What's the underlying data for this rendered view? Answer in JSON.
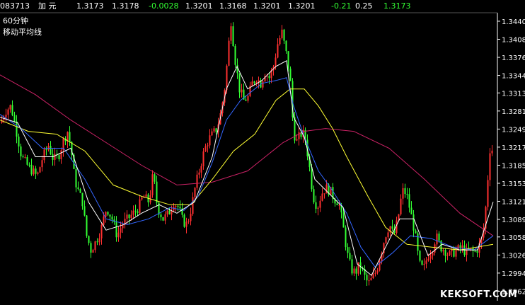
{
  "ticker": {
    "code": "083713",
    "name": "加 元",
    "values": [
      {
        "text": "1.3173",
        "color": "#ffffff"
      },
      {
        "text": "1.3178",
        "color": "#ffffff"
      },
      {
        "text": "-0.0028",
        "color": "#33ff33"
      },
      {
        "text": "1.3201",
        "color": "#ffffff"
      },
      {
        "text": "1.3168",
        "color": "#ffffff"
      },
      {
        "text": "1.3201",
        "color": "#ffffff"
      },
      {
        "text": "1.3201",
        "color": "#ffffff"
      },
      {
        "text": "-0.21",
        "color": "#33ff33"
      },
      {
        "text": "0.25",
        "color": "#ffffff"
      },
      {
        "text": "1.3173",
        "color": "#33ff33"
      }
    ]
  },
  "panel": {
    "period_label": "60分钟",
    "indicator_label": "移动平均线"
  },
  "watermark": "KEKSOFT.COM",
  "chart_data": {
    "type": "line",
    "title": "",
    "xlabel": "",
    "ylabel": "",
    "ylim": [
      1.2945,
      1.3455
    ],
    "grid": false,
    "y_ticks": [
      "1.3440",
      "1.3408",
      "1.3376",
      "1.3344",
      "1.3313",
      "1.3281",
      "1.3249",
      "1.3217",
      "1.3185",
      "1.3153",
      "1.3121",
      "1.3089",
      "1.3058",
      "1.3026",
      "1.2994",
      "1.2962"
    ],
    "colors": {
      "up": "#ff3030",
      "down": "#33ff33",
      "background": "#000000",
      "axis": "#ffffff"
    },
    "price_path": [
      [
        0,
        1.326
      ],
      [
        8,
        1.3282
      ],
      [
        15,
        1.329
      ],
      [
        22,
        1.325
      ],
      [
        30,
        1.32
      ],
      [
        38,
        1.3185
      ],
      [
        45,
        1.3175
      ],
      [
        52,
        1.3165
      ],
      [
        60,
        1.32
      ],
      [
        68,
        1.322
      ],
      [
        75,
        1.3195
      ],
      [
        82,
        1.32
      ],
      [
        88,
        1.3225
      ],
      [
        95,
        1.3245
      ],
      [
        100,
        1.3215
      ],
      [
        105,
        1.316
      ],
      [
        110,
        1.314
      ],
      [
        116,
        1.312
      ],
      [
        122,
        1.306
      ],
      [
        128,
        1.3035
      ],
      [
        135,
        1.305
      ],
      [
        142,
        1.307
      ],
      [
        150,
        1.311
      ],
      [
        158,
        1.309
      ],
      [
        165,
        1.306
      ],
      [
        172,
        1.308
      ],
      [
        180,
        1.309
      ],
      [
        188,
        1.31
      ],
      [
        195,
        1.311
      ],
      [
        202,
        1.313
      ],
      [
        210,
        1.312
      ],
      [
        216,
        1.317
      ],
      [
        222,
        1.311
      ],
      [
        230,
        1.309
      ],
      [
        238,
        1.31
      ],
      [
        245,
        1.312
      ],
      [
        252,
        1.311
      ],
      [
        258,
        1.3085
      ],
      [
        264,
        1.308
      ],
      [
        270,
        1.311
      ],
      [
        276,
        1.315
      ],
      [
        282,
        1.318
      ],
      [
        288,
        1.321
      ],
      [
        294,
        1.323
      ],
      [
        300,
        1.324
      ],
      [
        306,
        1.325
      ],
      [
        312,
        1.328
      ],
      [
        318,
        1.333
      ],
      [
        322,
        1.339
      ],
      [
        326,
        1.344
      ],
      [
        332,
        1.337
      ],
      [
        338,
        1.332
      ],
      [
        344,
        1.33
      ],
      [
        350,
        1.3305
      ],
      [
        356,
        1.333
      ],
      [
        362,
        1.334
      ],
      [
        368,
        1.333
      ],
      [
        374,
        1.335
      ],
      [
        380,
        1.334
      ],
      [
        386,
        1.336
      ],
      [
        392,
        1.34
      ],
      [
        398,
        1.342
      ],
      [
        402,
        1.3395
      ],
      [
        406,
        1.337
      ],
      [
        410,
        1.333
      ],
      [
        414,
        1.325
      ],
      [
        418,
        1.3225
      ],
      [
        424,
        1.324
      ],
      [
        430,
        1.324
      ],
      [
        436,
        1.319
      ],
      [
        442,
        1.313
      ],
      [
        448,
        1.311
      ],
      [
        454,
        1.3135
      ],
      [
        460,
        1.3145
      ],
      [
        466,
        1.314
      ],
      [
        472,
        1.3125
      ],
      [
        478,
        1.312
      ],
      [
        484,
        1.308
      ],
      [
        490,
        1.303
      ],
      [
        496,
        1.3
      ],
      [
        502,
        1.2995
      ],
      [
        508,
        1.301
      ],
      [
        514,
        1.299
      ],
      [
        520,
        1.2975
      ],
      [
        526,
        1.2985
      ],
      [
        532,
        1.3
      ],
      [
        538,
        1.303
      ],
      [
        544,
        1.306
      ],
      [
        550,
        1.308
      ],
      [
        556,
        1.306
      ],
      [
        562,
        1.309
      ],
      [
        568,
        1.314
      ],
      [
        574,
        1.3135
      ],
      [
        580,
        1.31
      ],
      [
        586,
        1.3065
      ],
      [
        592,
        1.301
      ],
      [
        598,
        1.3
      ],
      [
        604,
        1.3025
      ],
      [
        610,
        1.3035
      ],
      [
        616,
        1.306
      ],
      [
        622,
        1.304
      ],
      [
        628,
        1.3035
      ],
      [
        634,
        1.3025
      ],
      [
        640,
        1.303
      ],
      [
        646,
        1.3035
      ],
      [
        652,
        1.304
      ],
      [
        658,
        1.303
      ],
      [
        664,
        1.3035
      ],
      [
        670,
        1.303
      ],
      [
        676,
        1.304
      ],
      [
        682,
        1.306
      ],
      [
        686,
        1.311
      ],
      [
        690,
        1.318
      ],
      [
        693,
        1.323
      ],
      [
        697,
        1.3195
      ]
    ],
    "series": [
      {
        "color": "#cc2266",
        "points": [
          [
            0,
            1.3345
          ],
          [
            50,
            1.331
          ],
          [
            100,
            1.3265
          ],
          [
            150,
            1.3225
          ],
          [
            200,
            1.3185
          ],
          [
            250,
            1.315
          ],
          [
            300,
            1.3155
          ],
          [
            350,
            1.3175
          ],
          [
            400,
            1.3225
          ],
          [
            430,
            1.3245
          ],
          [
            460,
            1.325
          ],
          [
            500,
            1.3245
          ],
          [
            550,
            1.3215
          ],
          [
            600,
            1.316
          ],
          [
            650,
            1.31
          ],
          [
            697,
            1.306
          ]
        ]
      },
      {
        "color": "#ffff33",
        "points": [
          [
            0,
            1.3265
          ],
          [
            40,
            1.3245
          ],
          [
            80,
            1.324
          ],
          [
            120,
            1.321
          ],
          [
            160,
            1.315
          ],
          [
            200,
            1.313
          ],
          [
            240,
            1.3115
          ],
          [
            270,
            1.3115
          ],
          [
            300,
            1.316
          ],
          [
            330,
            1.321
          ],
          [
            360,
            1.324
          ],
          [
            390,
            1.33
          ],
          [
            410,
            1.332
          ],
          [
            430,
            1.332
          ],
          [
            450,
            1.329
          ],
          [
            470,
            1.325
          ],
          [
            490,
            1.32
          ],
          [
            520,
            1.313
          ],
          [
            545,
            1.3075
          ],
          [
            575,
            1.3045
          ],
          [
            610,
            1.304
          ],
          [
            650,
            1.3035
          ],
          [
            697,
            1.3045
          ]
        ]
      },
      {
        "color": "#3366ff",
        "points": [
          [
            0,
            1.3275
          ],
          [
            30,
            1.325
          ],
          [
            60,
            1.3215
          ],
          [
            90,
            1.3215
          ],
          [
            120,
            1.316
          ],
          [
            150,
            1.309
          ],
          [
            180,
            1.308
          ],
          [
            210,
            1.309
          ],
          [
            240,
            1.311
          ],
          [
            260,
            1.3105
          ],
          [
            280,
            1.313
          ],
          [
            300,
            1.319
          ],
          [
            320,
            1.3265
          ],
          [
            340,
            1.33
          ],
          [
            370,
            1.333
          ],
          [
            390,
            1.3335
          ],
          [
            405,
            1.334
          ],
          [
            415,
            1.329
          ],
          [
            430,
            1.3235
          ],
          [
            450,
            1.3175
          ],
          [
            470,
            1.314
          ],
          [
            490,
            1.31
          ],
          [
            510,
            1.304
          ],
          [
            530,
            1.3005
          ],
          [
            555,
            1.303
          ],
          [
            580,
            1.306
          ],
          [
            610,
            1.3055
          ],
          [
            640,
            1.304
          ],
          [
            670,
            1.3035
          ],
          [
            697,
            1.306
          ]
        ]
      },
      {
        "color": "#ffffff",
        "points": [
          [
            0,
            1.327
          ],
          [
            25,
            1.326
          ],
          [
            50,
            1.32
          ],
          [
            75,
            1.32
          ],
          [
            100,
            1.3215
          ],
          [
            125,
            1.312
          ],
          [
            150,
            1.307
          ],
          [
            175,
            1.308
          ],
          [
            200,
            1.31
          ],
          [
            225,
            1.3115
          ],
          [
            250,
            1.31
          ],
          [
            275,
            1.312
          ],
          [
            300,
            1.32
          ],
          [
            320,
            1.332
          ],
          [
            335,
            1.336
          ],
          [
            350,
            1.332
          ],
          [
            370,
            1.3335
          ],
          [
            390,
            1.336
          ],
          [
            405,
            1.337
          ],
          [
            415,
            1.327
          ],
          [
            430,
            1.3235
          ],
          [
            445,
            1.316
          ],
          [
            465,
            1.3135
          ],
          [
            485,
            1.311
          ],
          [
            505,
            1.301
          ],
          [
            525,
            1.299
          ],
          [
            545,
            1.304
          ],
          [
            565,
            1.309
          ],
          [
            585,
            1.309
          ],
          [
            605,
            1.3025
          ],
          [
            625,
            1.3045
          ],
          [
            650,
            1.3035
          ],
          [
            675,
            1.3035
          ],
          [
            697,
            1.312
          ]
        ]
      }
    ]
  }
}
